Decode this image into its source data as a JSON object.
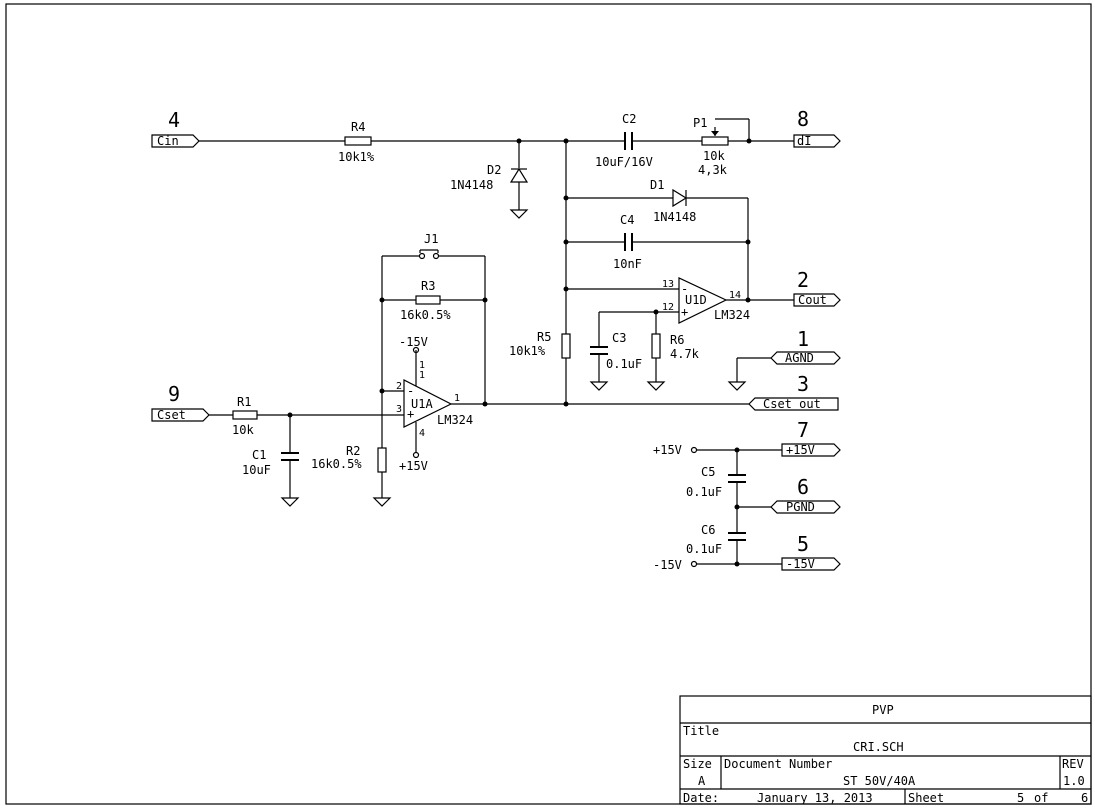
{
  "connectors": [
    {
      "num": "4",
      "label": "Cin"
    },
    {
      "num": "8",
      "label": "dI"
    },
    {
      "num": "2",
      "label": "Cout"
    },
    {
      "num": "1",
      "label": "AGND"
    },
    {
      "num": "3",
      "label": "Cset out"
    },
    {
      "num": "9",
      "label": "Cset"
    },
    {
      "num": "7",
      "label": "+15V"
    },
    {
      "num": "6",
      "label": "PGND"
    },
    {
      "num": "5",
      "label": "-15V"
    }
  ],
  "components": {
    "R4": {
      "ref": "R4",
      "value": "10k1%"
    },
    "R1": {
      "ref": "R1",
      "value": "10k"
    },
    "R2": {
      "ref": "R2",
      "value": "16k0.5%"
    },
    "R3": {
      "ref": "R3",
      "value": "16k0.5%"
    },
    "R5": {
      "ref": "R5",
      "value": "10k1%"
    },
    "R6": {
      "ref": "R6",
      "value": "4.7k"
    },
    "P1": {
      "ref": "P1",
      "value": "10k",
      "value2": "4,3k"
    },
    "C1": {
      "ref": "C1",
      "value": "10uF"
    },
    "C2": {
      "ref": "C2",
      "value": "10uF/16V"
    },
    "C3": {
      "ref": "C3",
      "value": "0.1uF"
    },
    "C4": {
      "ref": "C4",
      "value": "10nF"
    },
    "C5": {
      "ref": "C5",
      "value": "0.1uF"
    },
    "C6": {
      "ref": "C6",
      "value": "0.1uF"
    },
    "D1": {
      "ref": "D1",
      "value": "1N4148"
    },
    "D2": {
      "ref": "D2",
      "value": "1N4148"
    },
    "J1": {
      "ref": "J1"
    },
    "U1A": {
      "ref": "U1A",
      "value": "LM324",
      "pin_plus": "3",
      "pin_minus": "2",
      "pin_out": "1",
      "pin_vneg": "1\n1",
      "pin_vpos": "4"
    },
    "U1D": {
      "ref": "U1D",
      "value": "LM324",
      "pin_minus": "13",
      "pin_plus": "12",
      "pin_out": "14"
    }
  },
  "power": {
    "u1a_neg": "-15V",
    "u1a_pos": "+15V",
    "rail_pos": "+15V",
    "rail_neg": "-15V"
  },
  "title_block": {
    "company": "PVP",
    "title_label": "Title",
    "title": "CRI.SCH",
    "size_label": "Size",
    "size": "A",
    "doc_label": "Document Number",
    "doc_number": "ST 50V/40A",
    "rev_label": "REV",
    "rev": "1.0",
    "date_label": "Date:",
    "date": "January 13, 2013",
    "sheet_label": "Sheet",
    "sheet": "5",
    "of_label": "of",
    "sheets": "6"
  }
}
